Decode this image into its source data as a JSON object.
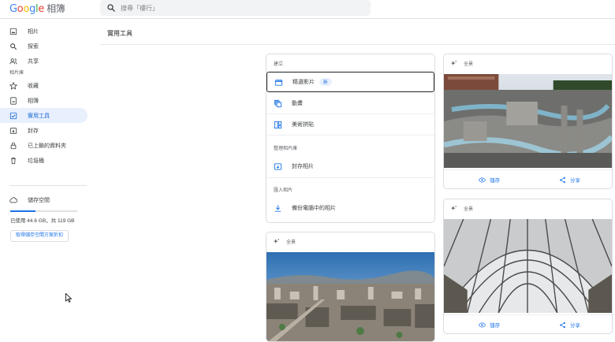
{
  "app": {
    "logo_google": [
      "G",
      "o",
      "o",
      "g",
      "l",
      "e"
    ],
    "logo_suffix": "相簿"
  },
  "search": {
    "placeholder": "搜尋「樓行」",
    "icon": "search-icon"
  },
  "sidebar": {
    "items": [
      {
        "label": "相片",
        "icon": "photo-icon"
      },
      {
        "label": "探索",
        "icon": "search-icon"
      },
      {
        "label": "共享",
        "icon": "people-icon"
      }
    ],
    "section_label": "相片庫",
    "library_items": [
      {
        "label": "收藏",
        "icon": "star-icon"
      },
      {
        "label": "相簿",
        "icon": "album-icon"
      },
      {
        "label": "實用工具",
        "icon": "utilities-icon",
        "active": true
      },
      {
        "label": "封存",
        "icon": "archive-icon"
      },
      {
        "label": "已上鎖的資料夾",
        "icon": "lock-icon"
      },
      {
        "label": "垃圾桶",
        "icon": "trash-icon"
      }
    ]
  },
  "storage": {
    "label": "儲存空間",
    "icon": "cloud-icon",
    "usage_text": "已使用 44.6 GB，共 119 GB",
    "used_fraction": 0.375,
    "buy_label": "取得儲存空間方案折扣"
  },
  "main": {
    "title": "實用工具",
    "create": {
      "group_create": "建立",
      "items": [
        {
          "label": "精選影片",
          "icon": "movie-icon",
          "badge": "新"
        },
        {
          "label": "動畫",
          "icon": "animation-icon"
        },
        {
          "label": "美術拼貼",
          "icon": "collage-icon"
        }
      ],
      "group_organize": "整理相片庫",
      "organize_items": [
        {
          "label": "封存相片",
          "icon": "archive-icon"
        }
      ],
      "group_import": "匯入相片",
      "import_items": [
        {
          "label": "備份電腦中的相片",
          "icon": "download-icon"
        }
      ]
    },
    "cards": [
      {
        "heading": "全景",
        "save_label": "儲存",
        "share_label": "分享"
      },
      {
        "heading": "全景",
        "save_label": "儲存",
        "share_label": "分享"
      },
      {
        "heading": "全景"
      }
    ]
  },
  "colors": {
    "accent": "#1a73e8",
    "active_bg": "#e8f0fe"
  }
}
